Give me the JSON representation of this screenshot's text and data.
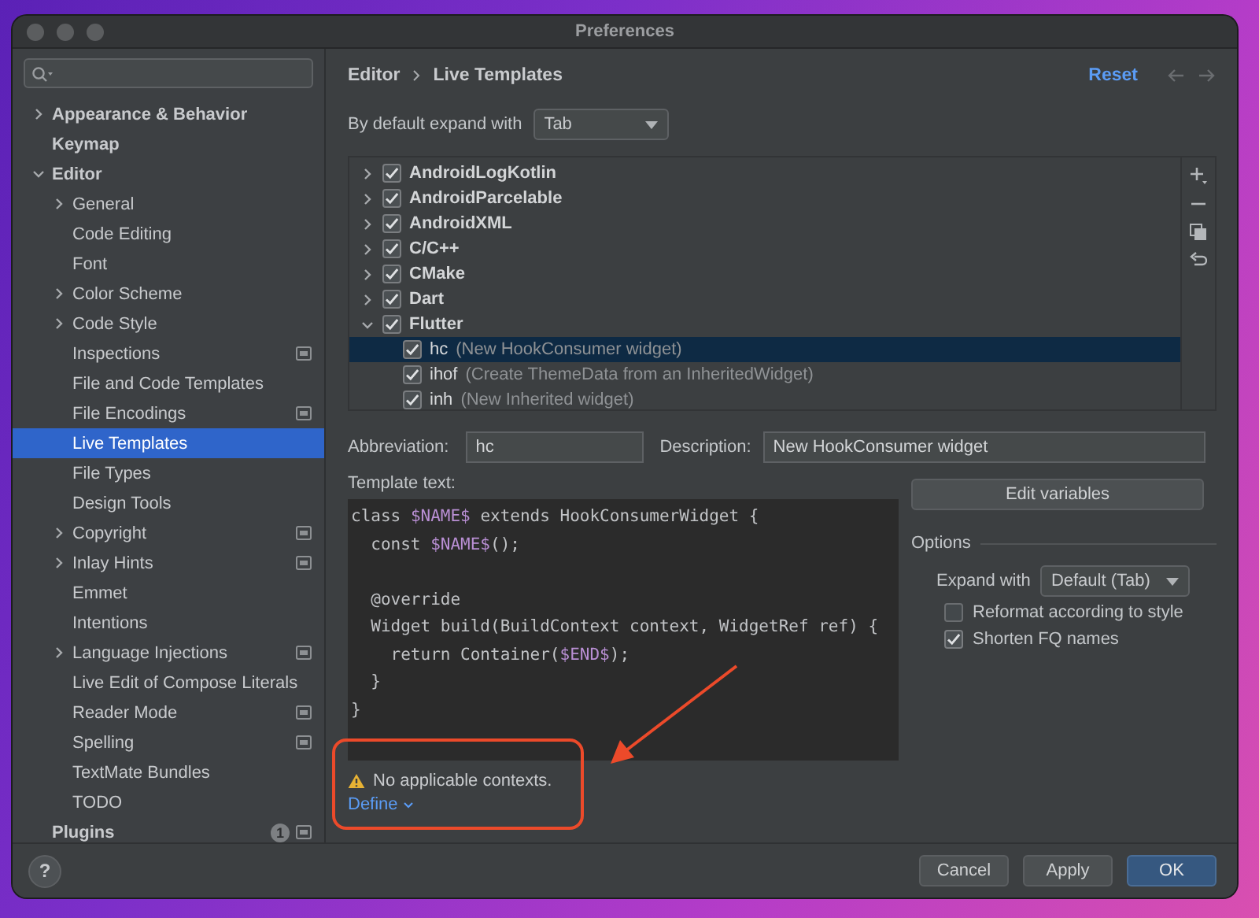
{
  "window": {
    "title": "Preferences"
  },
  "sidebar": {
    "items": [
      {
        "label": "Appearance & Behavior",
        "kind": "group",
        "expanded": false,
        "selected": false,
        "scoped": false
      },
      {
        "label": "Keymap",
        "kind": "leaf",
        "selected": false,
        "scoped": false
      },
      {
        "label": "Editor",
        "kind": "group",
        "expanded": true,
        "selected": false,
        "scoped": false,
        "children": [
          {
            "label": "General",
            "kind": "group",
            "expanded": false,
            "selected": false,
            "scoped": false
          },
          {
            "label": "Code Editing",
            "kind": "leaf",
            "selected": false,
            "scoped": false
          },
          {
            "label": "Font",
            "kind": "leaf",
            "selected": false,
            "scoped": false
          },
          {
            "label": "Color Scheme",
            "kind": "group",
            "expanded": false,
            "selected": false,
            "scoped": false
          },
          {
            "label": "Code Style",
            "kind": "group",
            "expanded": false,
            "selected": false,
            "scoped": false
          },
          {
            "label": "Inspections",
            "kind": "leaf",
            "selected": false,
            "scoped": true
          },
          {
            "label": "File and Code Templates",
            "kind": "leaf",
            "selected": false,
            "scoped": false
          },
          {
            "label": "File Encodings",
            "kind": "leaf",
            "selected": false,
            "scoped": true
          },
          {
            "label": "Live Templates",
            "kind": "leaf",
            "selected": true,
            "scoped": false
          },
          {
            "label": "File Types",
            "kind": "leaf",
            "selected": false,
            "scoped": false
          },
          {
            "label": "Design Tools",
            "kind": "leaf",
            "selected": false,
            "scoped": false
          },
          {
            "label": "Copyright",
            "kind": "group",
            "expanded": false,
            "selected": false,
            "scoped": true
          },
          {
            "label": "Inlay Hints",
            "kind": "group",
            "expanded": false,
            "selected": false,
            "scoped": true
          },
          {
            "label": "Emmet",
            "kind": "leaf",
            "selected": false,
            "scoped": false
          },
          {
            "label": "Intentions",
            "kind": "leaf",
            "selected": false,
            "scoped": false
          },
          {
            "label": "Language Injections",
            "kind": "group",
            "expanded": false,
            "selected": false,
            "scoped": true
          },
          {
            "label": "Live Edit of Compose Literals",
            "kind": "leaf",
            "selected": false,
            "scoped": false
          },
          {
            "label": "Reader Mode",
            "kind": "leaf",
            "selected": false,
            "scoped": true
          },
          {
            "label": "Spelling",
            "kind": "leaf",
            "selected": false,
            "scoped": true
          },
          {
            "label": "TextMate Bundles",
            "kind": "leaf",
            "selected": false,
            "scoped": false
          },
          {
            "label": "TODO",
            "kind": "leaf",
            "selected": false,
            "scoped": false
          }
        ]
      },
      {
        "label": "Plugins",
        "kind": "leaf",
        "selected": false,
        "scoped": true,
        "badge": "1"
      }
    ]
  },
  "header": {
    "breadcrumb": [
      "Editor",
      "Live Templates"
    ],
    "reset": "Reset"
  },
  "expand_default": {
    "label": "By default expand with",
    "value": "Tab"
  },
  "templates": [
    {
      "label": "AndroidLogKotlin",
      "checked": true,
      "expanded": false,
      "selected": false
    },
    {
      "label": "AndroidParcelable",
      "checked": true,
      "expanded": false,
      "selected": false
    },
    {
      "label": "AndroidXML",
      "checked": true,
      "expanded": false,
      "selected": false
    },
    {
      "label": "C/C++",
      "checked": true,
      "expanded": false,
      "selected": false
    },
    {
      "label": "CMake",
      "checked": true,
      "expanded": false,
      "selected": false
    },
    {
      "label": "Dart",
      "checked": true,
      "expanded": false,
      "selected": false
    },
    {
      "label": "Flutter",
      "checked": true,
      "expanded": true,
      "selected": false,
      "children": [
        {
          "abbreviation": "hc",
          "description": "(New HookConsumer widget)",
          "checked": true,
          "selected": true
        },
        {
          "abbreviation": "ihof",
          "description": "(Create ThemeData from an InheritedWidget)",
          "checked": true,
          "selected": false
        },
        {
          "abbreviation": "inh",
          "description": "(New Inherited widget)",
          "checked": true,
          "selected": false
        }
      ]
    }
  ],
  "editor": {
    "abbreviation": {
      "label": "Abbreviation:",
      "value": "hc"
    },
    "description": {
      "label": "Description:",
      "value": "New HookConsumer widget"
    },
    "template_label": "Template text:",
    "template_text": "class $NAME$ extends HookConsumerWidget {\n  const $NAME$();\n\n  @override\n  Widget build(BuildContext context, WidgetRef ref) {\n    return Container($END$);\n  }\n}",
    "edit_variables": "Edit variables",
    "options": {
      "title": "Options",
      "expand_with": {
        "label": "Expand with",
        "value": "Default (Tab)"
      },
      "checkboxes": [
        {
          "label": "Reformat according to style",
          "checked": false
        },
        {
          "label": "Shorten FQ names",
          "checked": true
        }
      ]
    },
    "warning": "No applicable contexts.",
    "define": "Define"
  },
  "footer": {
    "help": "?",
    "buttons": [
      {
        "label": "Cancel",
        "default": false
      },
      {
        "label": "Apply",
        "default": false
      },
      {
        "label": "OK",
        "default": true
      }
    ]
  }
}
